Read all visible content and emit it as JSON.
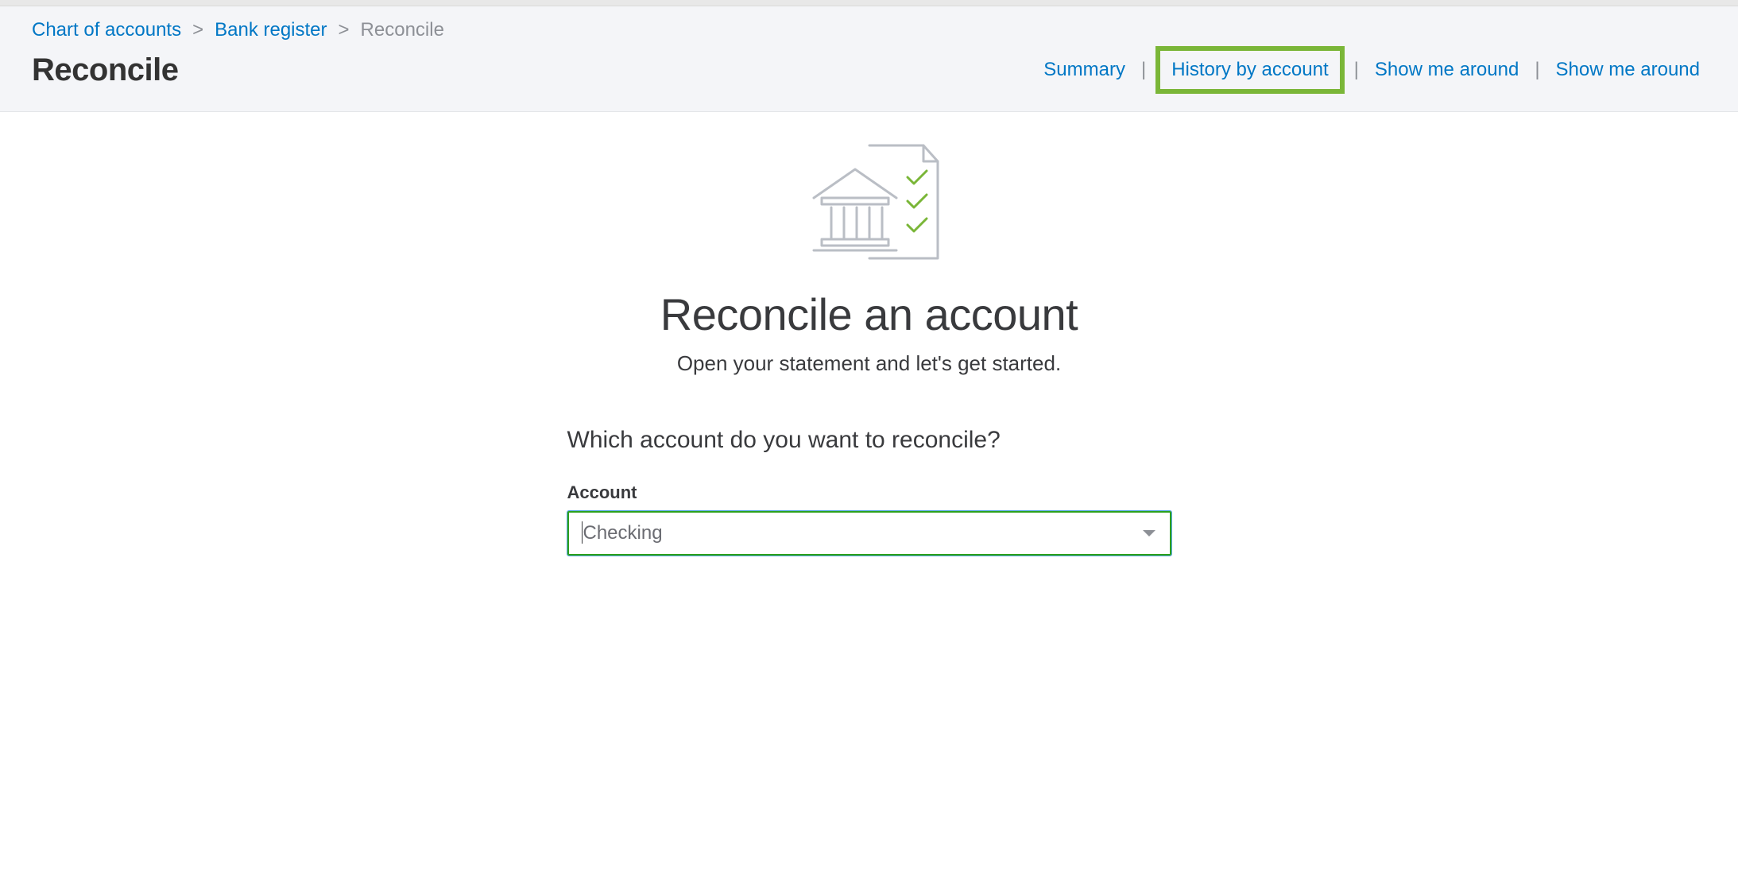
{
  "breadcrumb": {
    "items": [
      {
        "label": "Chart of accounts",
        "link": true
      },
      {
        "label": "Bank register",
        "link": true
      },
      {
        "label": "Reconcile",
        "link": false
      }
    ],
    "separator": ">"
  },
  "header": {
    "title": "Reconcile",
    "links": {
      "summary": "Summary",
      "history": "History by account",
      "show1": "Show me around",
      "show2": "Show me around"
    },
    "divider": "|"
  },
  "main": {
    "headline": "Reconcile an account",
    "subhead": "Open your statement and let's get started.",
    "question": "Which account do you want to reconcile?",
    "account_label": "Account",
    "account_value": "Checking"
  }
}
